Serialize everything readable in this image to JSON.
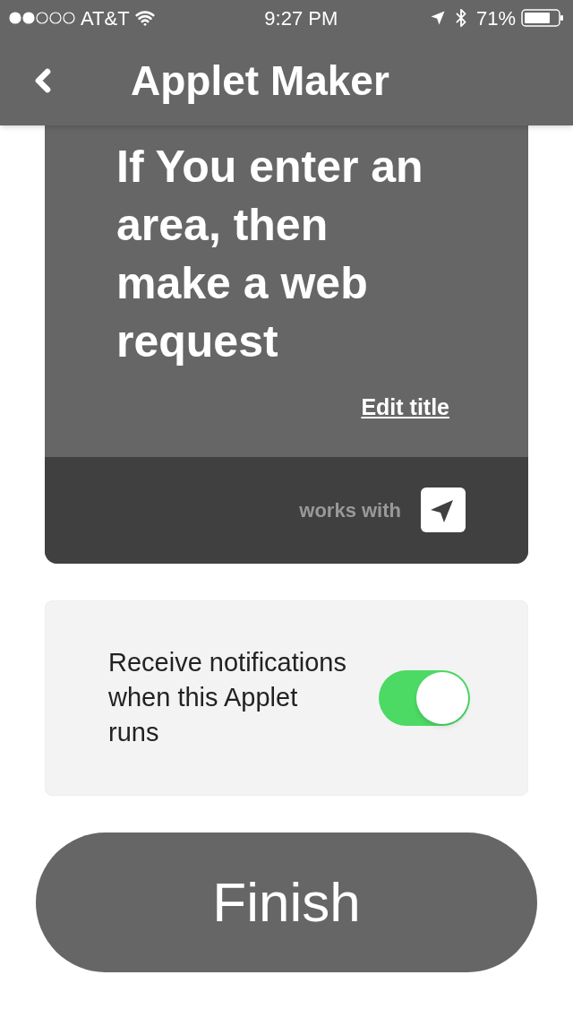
{
  "status_bar": {
    "carrier": "AT&T",
    "time": "9:27 PM",
    "battery": "71%"
  },
  "nav": {
    "title": "Applet Maker"
  },
  "applet": {
    "title": "If You enter an area, then make a web request",
    "edit_link": "Edit title",
    "works_with": "works with"
  },
  "notifications": {
    "label": "Receive notifications when this Applet runs",
    "on": true
  },
  "finish_button": "Finish"
}
